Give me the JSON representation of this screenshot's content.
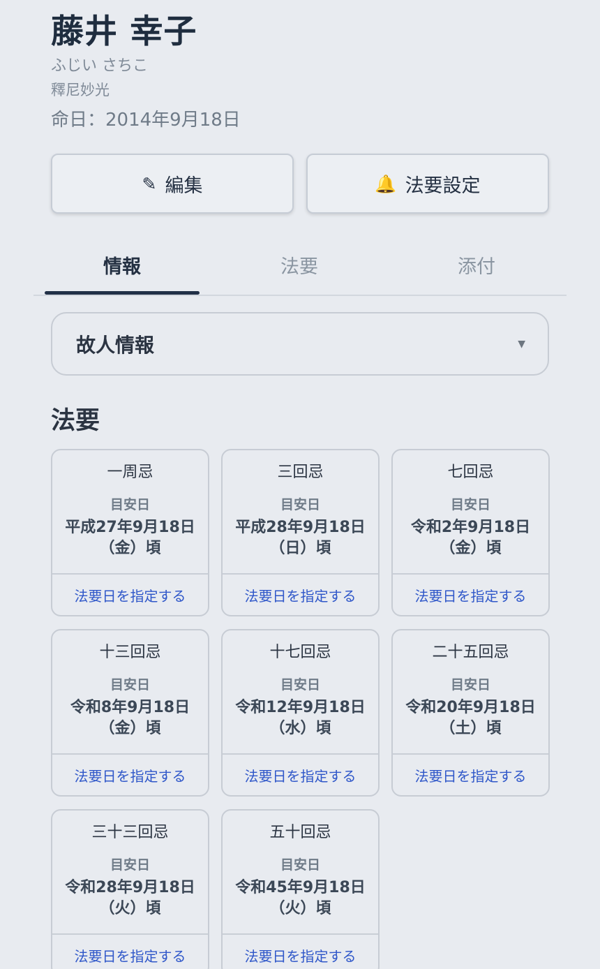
{
  "profile": {
    "name": "藤井 幸子",
    "kana": "ふじい さちこ",
    "buddhist_name": "釋尼妙光",
    "death_date": "命日：2014年9月18日"
  },
  "actions": {
    "edit_icon": "✎",
    "edit_label": "編集",
    "memorial_icon": "🔔",
    "memorial_label": "法要設定"
  },
  "tabs": [
    {
      "label": "情報",
      "active": true
    },
    {
      "label": "法要",
      "active": false
    },
    {
      "label": "添付",
      "active": false
    }
  ],
  "deceased_section": {
    "title": "故人情報",
    "caret": "▼"
  },
  "memorials": {
    "title": "法要",
    "items": [
      {
        "name": "一周忌",
        "label": "目安日",
        "date": "平成27年9月18日（金）頃",
        "action": "法要日を指定する"
      },
      {
        "name": "三回忌",
        "label": "目安日",
        "date": "平成28年9月18日（日）頃",
        "action": "法要日を指定する"
      },
      {
        "name": "七回忌",
        "label": "目安日",
        "date": "令和2年9月18日（金）頃",
        "action": "法要日を指定する"
      },
      {
        "name": "十三回忌",
        "label": "目安日",
        "date": "令和8年9月18日（金）頃",
        "action": "法要日を指定する"
      },
      {
        "name": "十七回忌",
        "label": "目安日",
        "date": "令和12年9月18日（水）頃",
        "action": "法要日を指定する"
      },
      {
        "name": "二十五回忌",
        "label": "目安日",
        "date": "令和20年9月18日（土）頃",
        "action": "法要日を指定する"
      },
      {
        "name": "三十三回忌",
        "label": "目安日",
        "date": "令和28年9月18日（火）頃",
        "action": "法要日を指定する"
      },
      {
        "name": "五十回忌",
        "label": "目安日",
        "date": "令和45年9月18日（火）頃",
        "action": "法要日を指定する"
      }
    ]
  }
}
